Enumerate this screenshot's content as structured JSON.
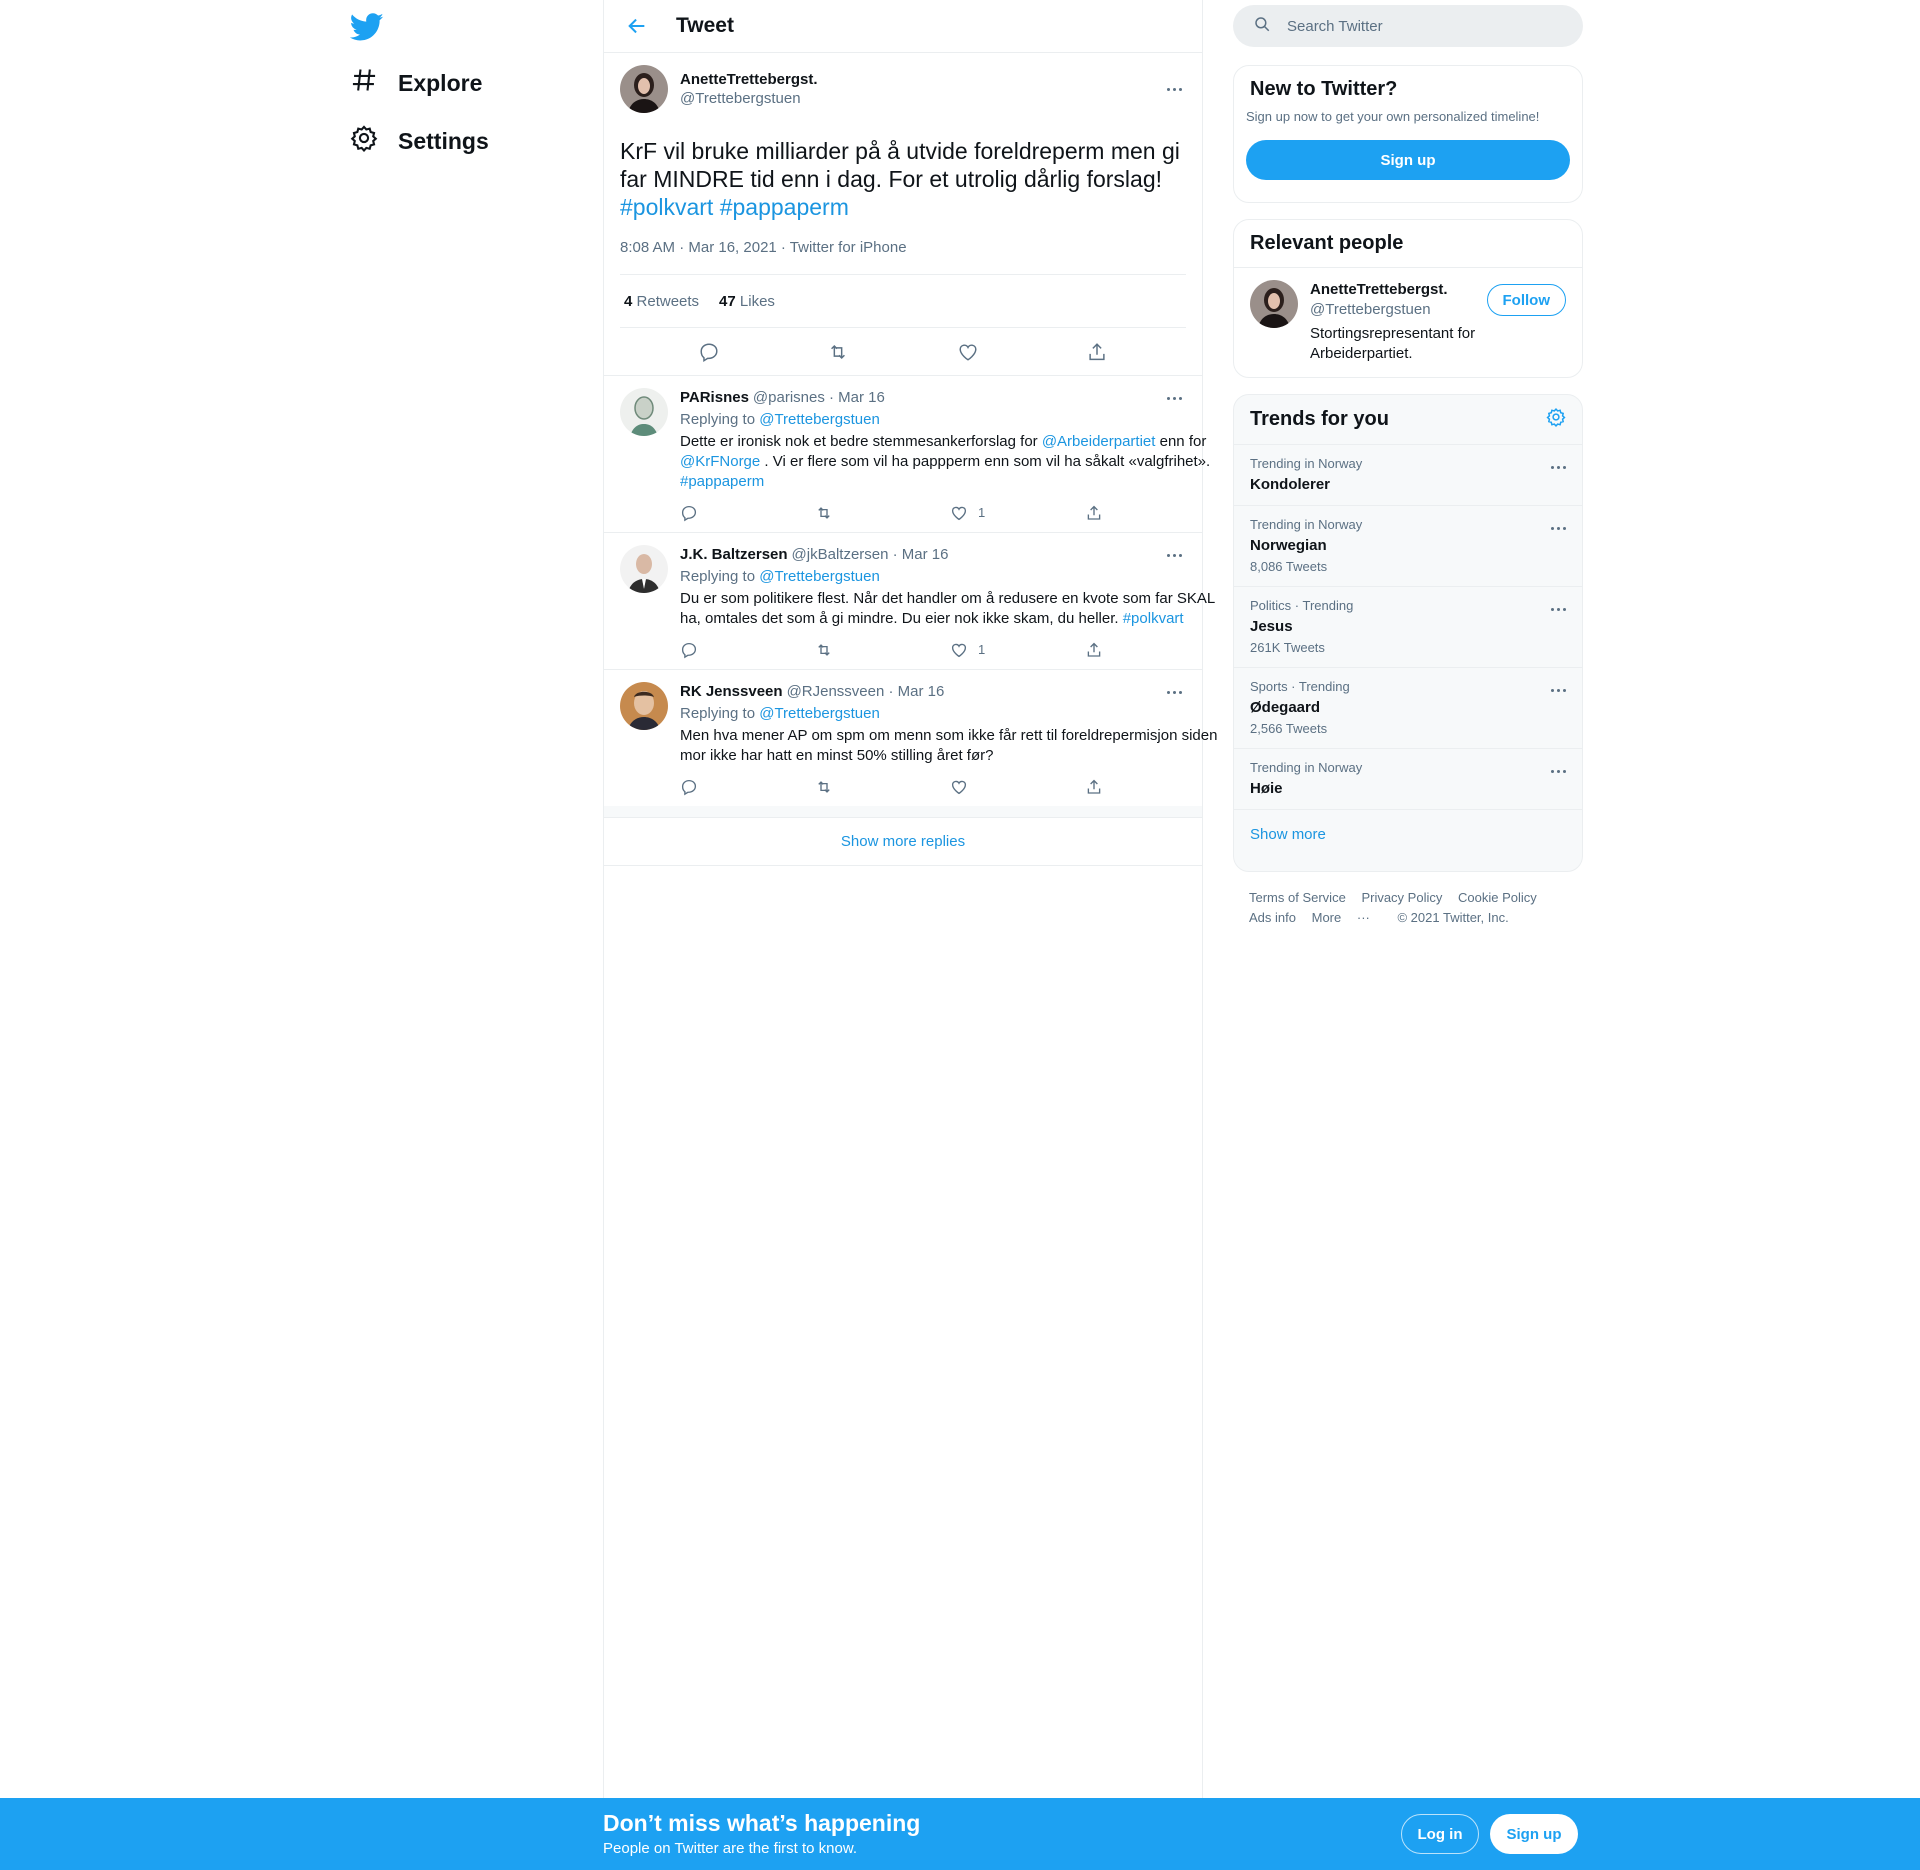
{
  "nav": {
    "explore": "Explore",
    "settings": "Settings"
  },
  "header": {
    "title": "Tweet"
  },
  "tweet": {
    "display_name": "AnetteTrettebergst.",
    "handle": "@Trettebergstuen",
    "text": "KrF vil bruke milliarder på å utvide foreldreperm men gi far MINDRE tid enn i dag. For et utrolig dårlig forslag!",
    "hashtag1": "#polkvart",
    "hashtag2": "#pappaperm",
    "meta": "8:08 AM · Mar 16, 2021 · Twitter for iPhone",
    "retweets_count": "4",
    "retweets_label": "Retweets",
    "likes_count": "47",
    "likes_label": "Likes"
  },
  "replies": [
    {
      "name": "PARisnes",
      "handle_date": "@parisnes · Mar 16",
      "replying_label": "Replying to",
      "replying_to": "@Trettebergstuen",
      "text_a": "Dette er ironisk nok et bedre stemmesankerforslag for",
      "mention1": "@Arbeiderpartiet",
      "text_b": "enn for",
      "mention2": "@KrFNorge",
      "text_c": ". Vi er flere som vil ha pappperm enn som vil ha såkalt «valgfrihet».",
      "hashtag": "#pappaperm",
      "likes": "1"
    },
    {
      "name": "J.K. Baltzersen",
      "handle_date": "@jkBaltzersen · Mar 16",
      "replying_label": "Replying to",
      "replying_to": "@Trettebergstuen",
      "text": "Du er som politikere flest. Når det handler om å redusere en kvote som far SKAL ha, omtales det som å gi mindre. Du eier nok ikke skam, du heller.",
      "hashtag": "#polkvart",
      "likes": "1"
    },
    {
      "name": "RK Jenssveen",
      "handle_date": "@RJenssveen · Mar 16",
      "replying_label": "Replying to",
      "replying_to": "@Trettebergstuen",
      "text": "Men hva mener AP om spm om menn som ikke får rett til foreldrepermisjon siden mor ikke har hatt en minst 50% stilling året før?"
    }
  ],
  "show_more_replies": "Show more replies",
  "search": {
    "placeholder": "Search Twitter"
  },
  "new_to_twitter": {
    "title": "New to Twitter?",
    "desc": "Sign up now to get your own personalized timeline!",
    "button": "Sign up"
  },
  "relevant_people": {
    "title": "Relevant people",
    "name": "AnetteTrettebergst.",
    "handle": "@Trettebergstuen",
    "bio": "Stortingsrepresentant for Arbeiderpartiet.",
    "follow": "Follow"
  },
  "trends": {
    "title": "Trends for you",
    "items": [
      {
        "context": "Trending in Norway",
        "name": "Kondolerer",
        "count": ""
      },
      {
        "context": "Trending in Norway",
        "name": "Norwegian",
        "count": "8,086 Tweets"
      },
      {
        "context": "Politics · Trending",
        "name": "Jesus",
        "count": "261K Tweets"
      },
      {
        "context": "Sports · Trending",
        "name": "Ødegaard",
        "count": "2,566 Tweets"
      },
      {
        "context": "Trending in Norway",
        "name": "Høie",
        "count": ""
      }
    ],
    "show_more": "Show more"
  },
  "footer": {
    "terms": "Terms of Service",
    "privacy": "Privacy Policy",
    "cookie": "Cookie Policy",
    "ads": "Ads info",
    "more": "More",
    "copyright": "© 2021 Twitter, Inc."
  },
  "bottom_bar": {
    "title": "Don’t miss what’s happening",
    "subtitle": "People on Twitter are the first to know.",
    "login": "Log in",
    "signup": "Sign up"
  },
  "colors": {
    "accent": "#1da1f2",
    "link": "#1b95e0",
    "secondary_text": "#5b7083",
    "border": "#ebeef0"
  },
  "icons": [
    "twitter-bird-icon",
    "hashtag-icon",
    "gear-icon",
    "back-arrow-icon",
    "more-dots-icon",
    "reply-icon",
    "retweet-icon",
    "like-icon",
    "share-icon",
    "search-icon"
  ]
}
